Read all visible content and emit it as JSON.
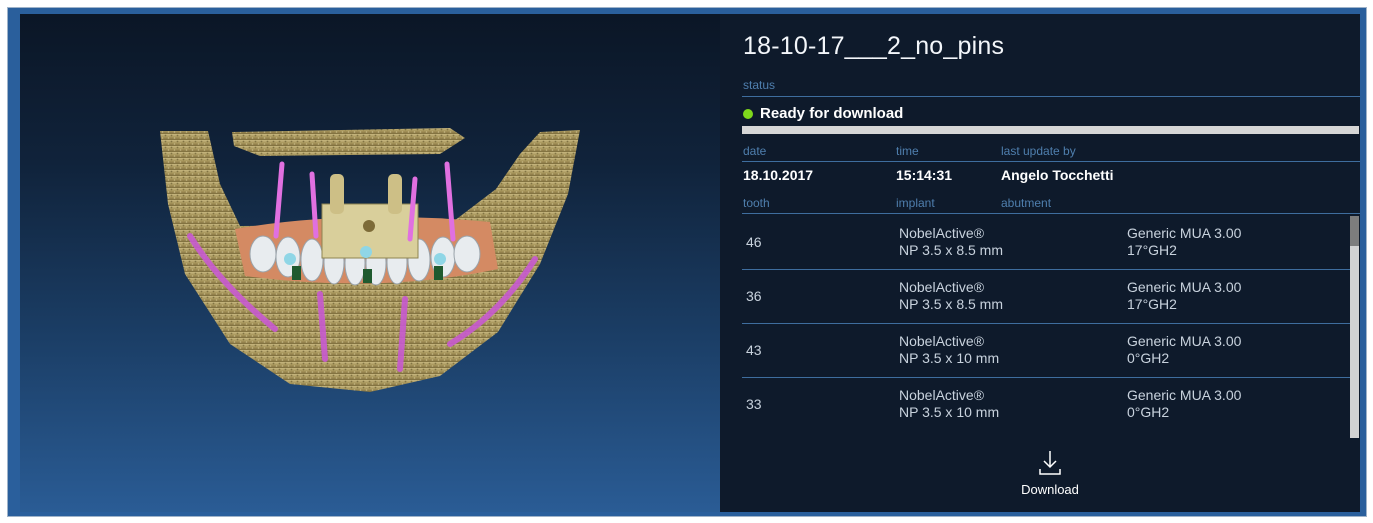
{
  "case": {
    "title": "18-10-17___2_no_pins",
    "status_label": "status",
    "status_text": "Ready for download",
    "status_color": "#7fd81c",
    "progress": 1.0
  },
  "meta": {
    "date_label": "date",
    "time_label": "time",
    "last_update_label": "last update by",
    "date": "18.10.2017",
    "time": "15:14:31",
    "last_update_by": "Angelo Tocchetti"
  },
  "table": {
    "headers": {
      "tooth": "tooth",
      "implant": "implant",
      "abutment": "abutment"
    },
    "rows": [
      {
        "tooth": "46",
        "implant_l1": "NobelActive®",
        "implant_l2": "NP 3.5 x 8.5 mm",
        "abutment_l1": "Generic MUA 3.00",
        "abutment_l2": "17°GH2"
      },
      {
        "tooth": "36",
        "implant_l1": "NobelActive®",
        "implant_l2": "NP 3.5 x 8.5 mm",
        "abutment_l1": "Generic MUA 3.00",
        "abutment_l2": "17°GH2"
      },
      {
        "tooth": "43",
        "implant_l1": "NobelActive®",
        "implant_l2": "NP 3.5 x 10 mm",
        "abutment_l1": "Generic MUA 3.00",
        "abutment_l2": "0°GH2"
      },
      {
        "tooth": "33",
        "implant_l1": "NobelActive®",
        "implant_l2": "NP 3.5 x 10 mm",
        "abutment_l1": "Generic MUA 3.00",
        "abutment_l2": "0°GH2"
      }
    ]
  },
  "actions": {
    "download_label": "Download",
    "download_icon": "download-icon"
  },
  "viewer": {
    "image_subject": "3d-jaw-scan"
  }
}
